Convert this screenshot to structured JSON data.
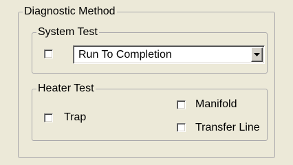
{
  "diagnostic_method": {
    "title": "Diagnostic Method",
    "system_test": {
      "title": "System Test",
      "enabled_checked": false,
      "mode_value": "Run To Completion",
      "dropdown_icon": "chevron-down-icon"
    },
    "heater_test": {
      "title": "Heater Test",
      "options": [
        {
          "label": "Trap",
          "checked": false
        },
        {
          "label": "Manifold",
          "checked": false
        },
        {
          "label": "Transfer Line",
          "checked": false
        }
      ]
    }
  },
  "colors": {
    "dialog_background": "#ece9d8",
    "groupbox_border": "#a7a6aa",
    "field_background": "#ffffff"
  }
}
